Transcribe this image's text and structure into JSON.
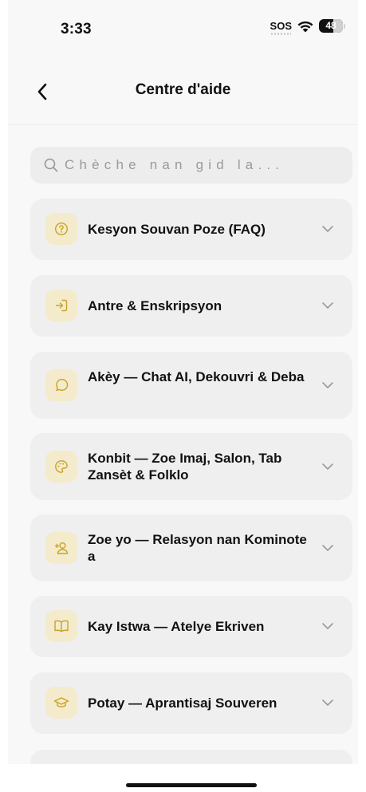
{
  "status_bar": {
    "time": "3:33",
    "sos": "SOS",
    "battery": "48"
  },
  "header": {
    "title": "Centre d'aide"
  },
  "search": {
    "placeholder": "Chèche nan gid la..."
  },
  "sections": [
    {
      "label": "Kesyon Souvan Poze (FAQ)",
      "icon": "question-circle-icon"
    },
    {
      "label": "Antre & Enskripsyon",
      "icon": "login-icon"
    },
    {
      "label": "Akèy — Chat AI, Dekouvri & Deba",
      "icon": "chat-bubble-icon"
    },
    {
      "label": "Konbit — Zoe Imaj, Salon, Tab Zansèt & Folklo",
      "icon": "palette-icon"
    },
    {
      "label": "Zoe yo — Relasyon nan Kominote a",
      "icon": "user-plus-icon"
    },
    {
      "label": "Kay Istwa — Atelye Ekriven",
      "icon": "open-book-icon"
    },
    {
      "label": "Potay — Aprantisaj Souveren",
      "icon": "graduation-cap-icon"
    }
  ],
  "colors": {
    "accent": "#c9a227",
    "icon_bg": "#f4ebcc",
    "card_bg": "#efefef"
  }
}
